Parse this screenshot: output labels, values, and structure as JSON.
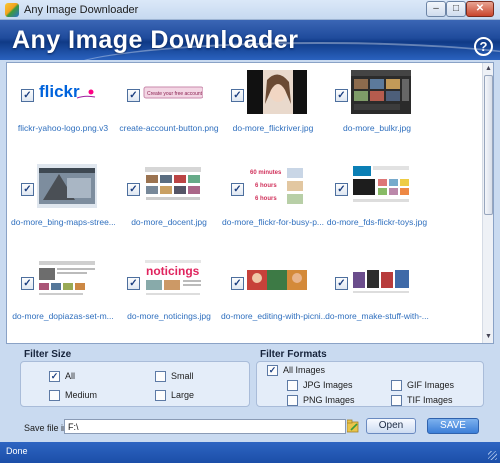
{
  "window": {
    "title": "Any Image Downloader",
    "controls": {
      "minimize": "–",
      "maximize": "□",
      "close": "✕"
    }
  },
  "banner": {
    "title": "Any Image Downloader",
    "help": "?"
  },
  "gallery": {
    "items": [
      {
        "name": "flickr-yahoo-logo.png.v3",
        "checked": true,
        "thumb": "flickr-logo"
      },
      {
        "name": "create-account-button.png",
        "checked": true,
        "thumb": "create-account"
      },
      {
        "name": "do-more_flickriver.jpg",
        "checked": true,
        "thumb": "portrait"
      },
      {
        "name": "do-more_bulkr.jpg",
        "checked": true,
        "thumb": "dark-gallery"
      },
      {
        "name": "do-more_bing-maps-stree...",
        "checked": true,
        "thumb": "street-map"
      },
      {
        "name": "do-more_docent.jpg",
        "checked": true,
        "thumb": "docent"
      },
      {
        "name": "do-more_flickr-for-busy-p...",
        "checked": true,
        "thumb": "busy-people"
      },
      {
        "name": "do-more_fds-flickr-toys.jpg",
        "checked": true,
        "thumb": "toys"
      },
      {
        "name": "do-more_dopiazas-set-m...",
        "checked": true,
        "thumb": "dopiaza"
      },
      {
        "name": "do-more_noticings.jpg",
        "checked": true,
        "thumb": "noticings"
      },
      {
        "name": "do-more_editing-with-picni...",
        "checked": true,
        "thumb": "picnik"
      },
      {
        "name": "do-more_make-stuff-with-...",
        "checked": true,
        "thumb": "make-stuff"
      }
    ],
    "thumb_text": {
      "flickr": "flickr",
      "create_account": "Create your free account",
      "noticings": "noticings",
      "busy1": "60 minutes",
      "busy2": "6 hours",
      "busy3": "6 hours"
    }
  },
  "filter_size": {
    "label": "Filter Size",
    "options": [
      {
        "label": "All",
        "checked": true
      },
      {
        "label": "Small",
        "checked": false
      },
      {
        "label": "Medium",
        "checked": false
      },
      {
        "label": "Large",
        "checked": false
      }
    ]
  },
  "filter_formats": {
    "label": "Filter Formats",
    "options": [
      {
        "label": "All Images",
        "checked": true
      },
      {
        "label": "JPG Images",
        "checked": false
      },
      {
        "label": "GIF Images",
        "checked": false
      },
      {
        "label": "PNG Images",
        "checked": false
      },
      {
        "label": "TIF Images",
        "checked": false
      }
    ]
  },
  "save": {
    "label": "Save file in",
    "path": "F:\\",
    "open_label": "Open",
    "save_label": "SAVE"
  },
  "status": {
    "text": "Done"
  },
  "colors": {
    "accent": "#2a62bf",
    "link": "#2f6fbe",
    "panel": "#e4edf9"
  }
}
